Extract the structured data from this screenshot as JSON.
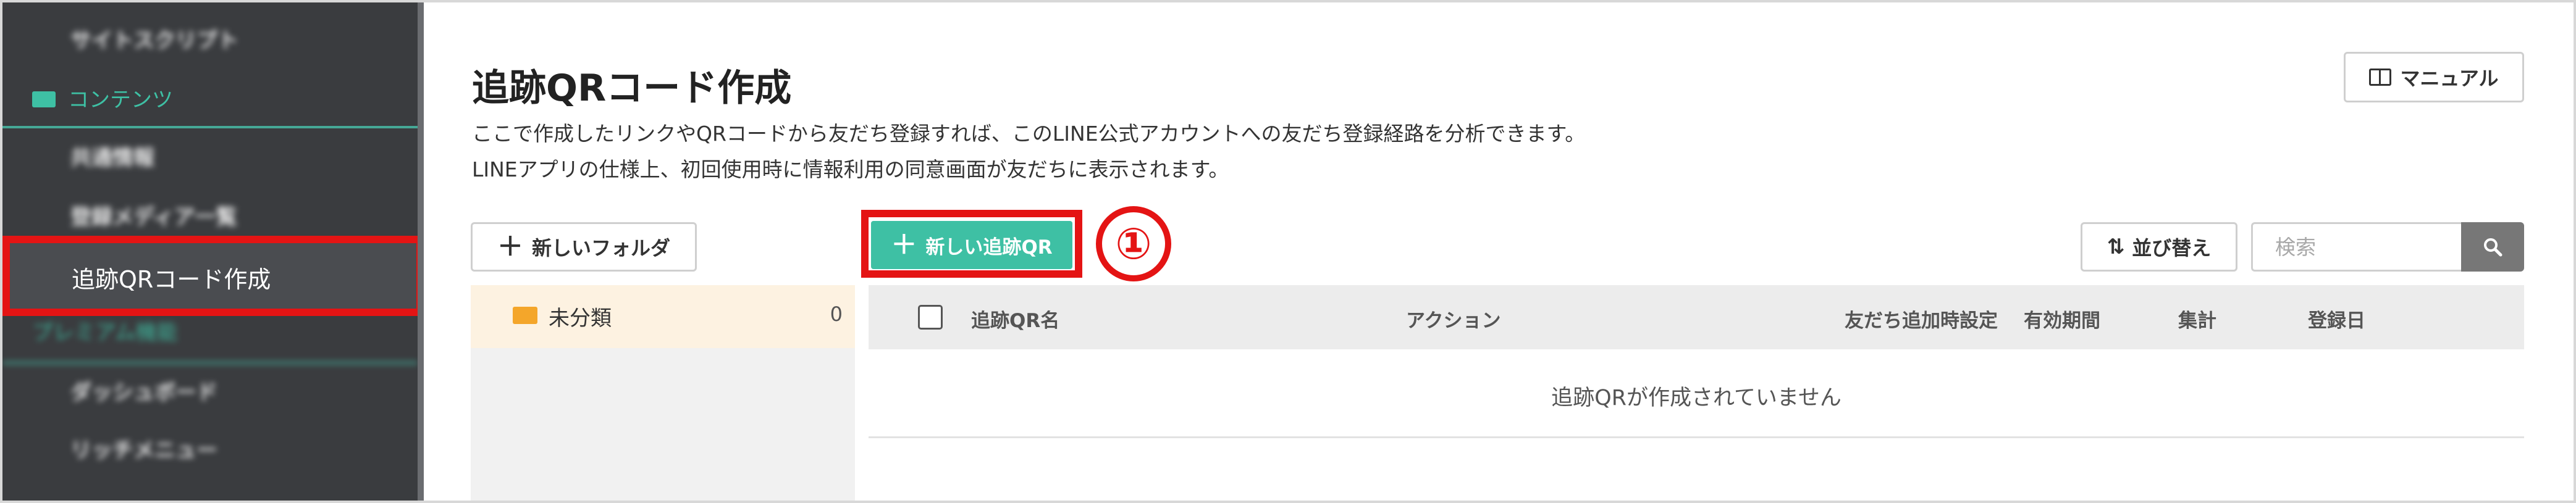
{
  "sidebar": {
    "item_site_script": "サイトスクリプト",
    "category_contents": "コンテンツ",
    "item_common_info": "共通情報",
    "item_media_list": "登録メディア一覧",
    "item_active": "追跡QRコード作成",
    "category_premium": "プレミアム機能",
    "item_dashboard": "ダッシュボード",
    "item_rich_menu": "リッチメニュー"
  },
  "header": {
    "title": "追跡QRコード作成",
    "description_line1": "ここで作成したリンクやQRコードから友だち登録すれば、このLINE公式アカウントへの友だち登録経路を分析できます。",
    "description_line2": "LINEアプリの仕様上、初回使用時に情報利用の同意画面が友だちに表示されます。",
    "manual_label": "マニュアル"
  },
  "toolbar": {
    "new_folder_label": "新しいフォルダ",
    "new_qr_label": "新しい追跡QR",
    "annotation_number": "①",
    "sort_label": "並び替え",
    "search_placeholder": "検索"
  },
  "folders": [
    {
      "name": "未分類",
      "count": "0"
    }
  ],
  "table": {
    "columns": [
      "追跡QR名",
      "アクション",
      "友だち追加時設定",
      "有効期間",
      "集計",
      "登録日"
    ],
    "empty_message": "追跡QRが作成されていません"
  },
  "colors": {
    "accent": "#3ec0a4",
    "highlight": "#e41414",
    "sidebar_bg": "#3a3c3f",
    "folder_icon": "#f4a62a"
  }
}
